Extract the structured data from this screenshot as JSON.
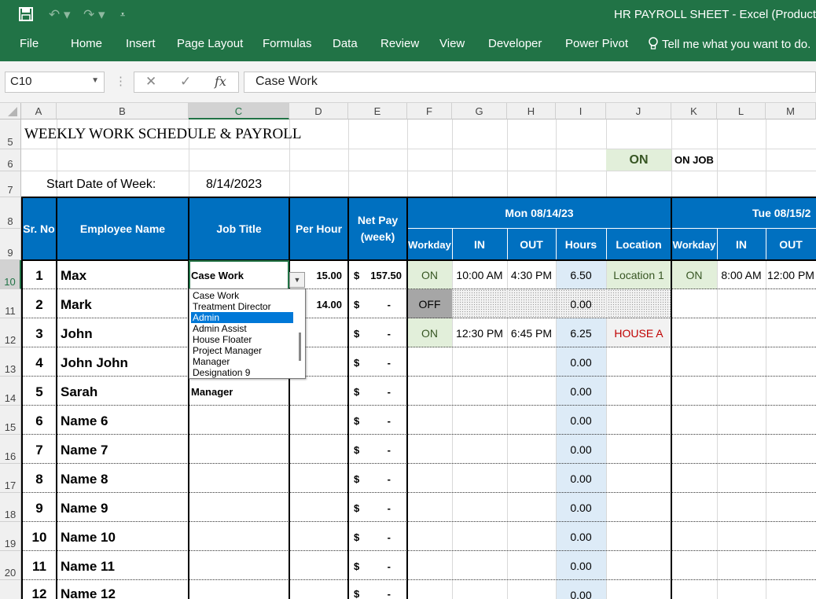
{
  "window": {
    "title": "HR PAYROLL SHEET - Excel (Product Ac",
    "quick_access": [
      "save-icon",
      "undo-icon",
      "redo-icon",
      "customize-icon"
    ]
  },
  "ribbon": {
    "tabs": [
      "File",
      "Home",
      "Insert",
      "Page Layout",
      "Formulas",
      "Data",
      "Review",
      "View",
      "Developer",
      "Power Pivot"
    ],
    "tell_me": "Tell me what you want to do."
  },
  "formula_bar": {
    "name_box": "C10",
    "formula": "Case Work",
    "fx": "fx"
  },
  "columns": [
    "A",
    "B",
    "C",
    "D",
    "E",
    "F",
    "G",
    "H",
    "I",
    "J",
    "K",
    "L",
    "M"
  ],
  "rows": [
    "5",
    "6",
    "7",
    "8",
    "9",
    "10",
    "11",
    "12",
    "13",
    "14",
    "15",
    "16",
    "17",
    "18",
    "19",
    "20"
  ],
  "sheet": {
    "title": "WEEKLY WORK SCHEDULE & PAYROLL",
    "on_label": "ON",
    "on_job_label": "ON JOB",
    "start_date_label": "Start Date of Week:",
    "start_date": "8/14/2023",
    "headers": {
      "sr_no": "Sr. No",
      "employee_name": "Employee Name",
      "job_title": "Job Title",
      "per_hour": "Per Hour",
      "net_pay": "Net Pay (week)",
      "day1": "Mon 08/14/23",
      "day2": "Tue 08/15/2",
      "workday": "Workday",
      "in": "IN",
      "out": "OUT",
      "hours": "Hours",
      "location": "Location"
    },
    "rows": [
      {
        "sr": "1",
        "name": "Max",
        "job": "Case Work",
        "rate": "15.00",
        "dollar": "$",
        "pay": "157.50",
        "workday": "ON",
        "in": "10:00 AM",
        "out": "4:30 PM",
        "hours": "6.50",
        "location": "Location 1",
        "workday2": "ON",
        "in2": "8:00 AM",
        "out2": "12:00 PM"
      },
      {
        "sr": "2",
        "name": "Mark",
        "job": "",
        "rate": "14.00",
        "dollar": "$",
        "pay": "-",
        "workday": "OFF",
        "in": "",
        "out": "",
        "hours": "0.00",
        "location": "",
        "workday2": "",
        "in2": "",
        "out2": ""
      },
      {
        "sr": "3",
        "name": "John",
        "job": "",
        "rate": "",
        "dollar": "$",
        "pay": "-",
        "workday": "ON",
        "in": "12:30 PM",
        "out": "6:45 PM",
        "hours": "6.25",
        "location": "HOUSE A",
        "workday2": "",
        "in2": "",
        "out2": ""
      },
      {
        "sr": "4",
        "name": "John John",
        "job": "",
        "rate": "",
        "dollar": "$",
        "pay": "-",
        "workday": "",
        "in": "",
        "out": "",
        "hours": "0.00",
        "location": "",
        "workday2": "",
        "in2": "",
        "out2": ""
      },
      {
        "sr": "5",
        "name": "Sarah",
        "job": "Manager",
        "rate": "",
        "dollar": "$",
        "pay": "-",
        "workday": "",
        "in": "",
        "out": "",
        "hours": "0.00",
        "location": "",
        "workday2": "",
        "in2": "",
        "out2": ""
      },
      {
        "sr": "6",
        "name": "Name 6",
        "job": "",
        "rate": "",
        "dollar": "$",
        "pay": "-",
        "workday": "",
        "in": "",
        "out": "",
        "hours": "0.00",
        "location": "",
        "workday2": "",
        "in2": "",
        "out2": ""
      },
      {
        "sr": "7",
        "name": "Name 7",
        "job": "",
        "rate": "",
        "dollar": "$",
        "pay": "-",
        "workday": "",
        "in": "",
        "out": "",
        "hours": "0.00",
        "location": "",
        "workday2": "",
        "in2": "",
        "out2": ""
      },
      {
        "sr": "8",
        "name": "Name 8",
        "job": "",
        "rate": "",
        "dollar": "$",
        "pay": "-",
        "workday": "",
        "in": "",
        "out": "",
        "hours": "0.00",
        "location": "",
        "workday2": "",
        "in2": "",
        "out2": ""
      },
      {
        "sr": "9",
        "name": "Name 9",
        "job": "",
        "rate": "",
        "dollar": "$",
        "pay": "-",
        "workday": "",
        "in": "",
        "out": "",
        "hours": "0.00",
        "location": "",
        "workday2": "",
        "in2": "",
        "out2": ""
      },
      {
        "sr": "10",
        "name": "Name 10",
        "job": "",
        "rate": "",
        "dollar": "$",
        "pay": "-",
        "workday": "",
        "in": "",
        "out": "",
        "hours": "0.00",
        "location": "",
        "workday2": "",
        "in2": "",
        "out2": ""
      },
      {
        "sr": "11",
        "name": "Name 11",
        "job": "",
        "rate": "",
        "dollar": "$",
        "pay": "-",
        "workday": "",
        "in": "",
        "out": "",
        "hours": "0.00",
        "location": "",
        "workday2": "",
        "in2": "",
        "out2": ""
      },
      {
        "sr": "12",
        "name": "Name 12",
        "job": "",
        "rate": "",
        "dollar": "$",
        "pay": "-",
        "workday": "",
        "in": "",
        "out": "",
        "hours": "0.00",
        "location": "",
        "workday2": "",
        "in2": "",
        "out2": ""
      }
    ]
  },
  "dropdown": {
    "options": [
      "Case Work",
      "Treatment Director",
      "Admin",
      "Admin Assist",
      "House Floater",
      "Project Manager",
      "Manager",
      "Designation 9"
    ],
    "highlighted": "Admin"
  },
  "colors": {
    "excel_green": "#217346",
    "header_blue": "#0070c0",
    "on_green_bg": "#e2efda",
    "on_green_text": "#375623",
    "off_gray_bg": "#a6a6a6",
    "hours_blue_bg": "#ddebf7",
    "house_red": "#c00000"
  }
}
